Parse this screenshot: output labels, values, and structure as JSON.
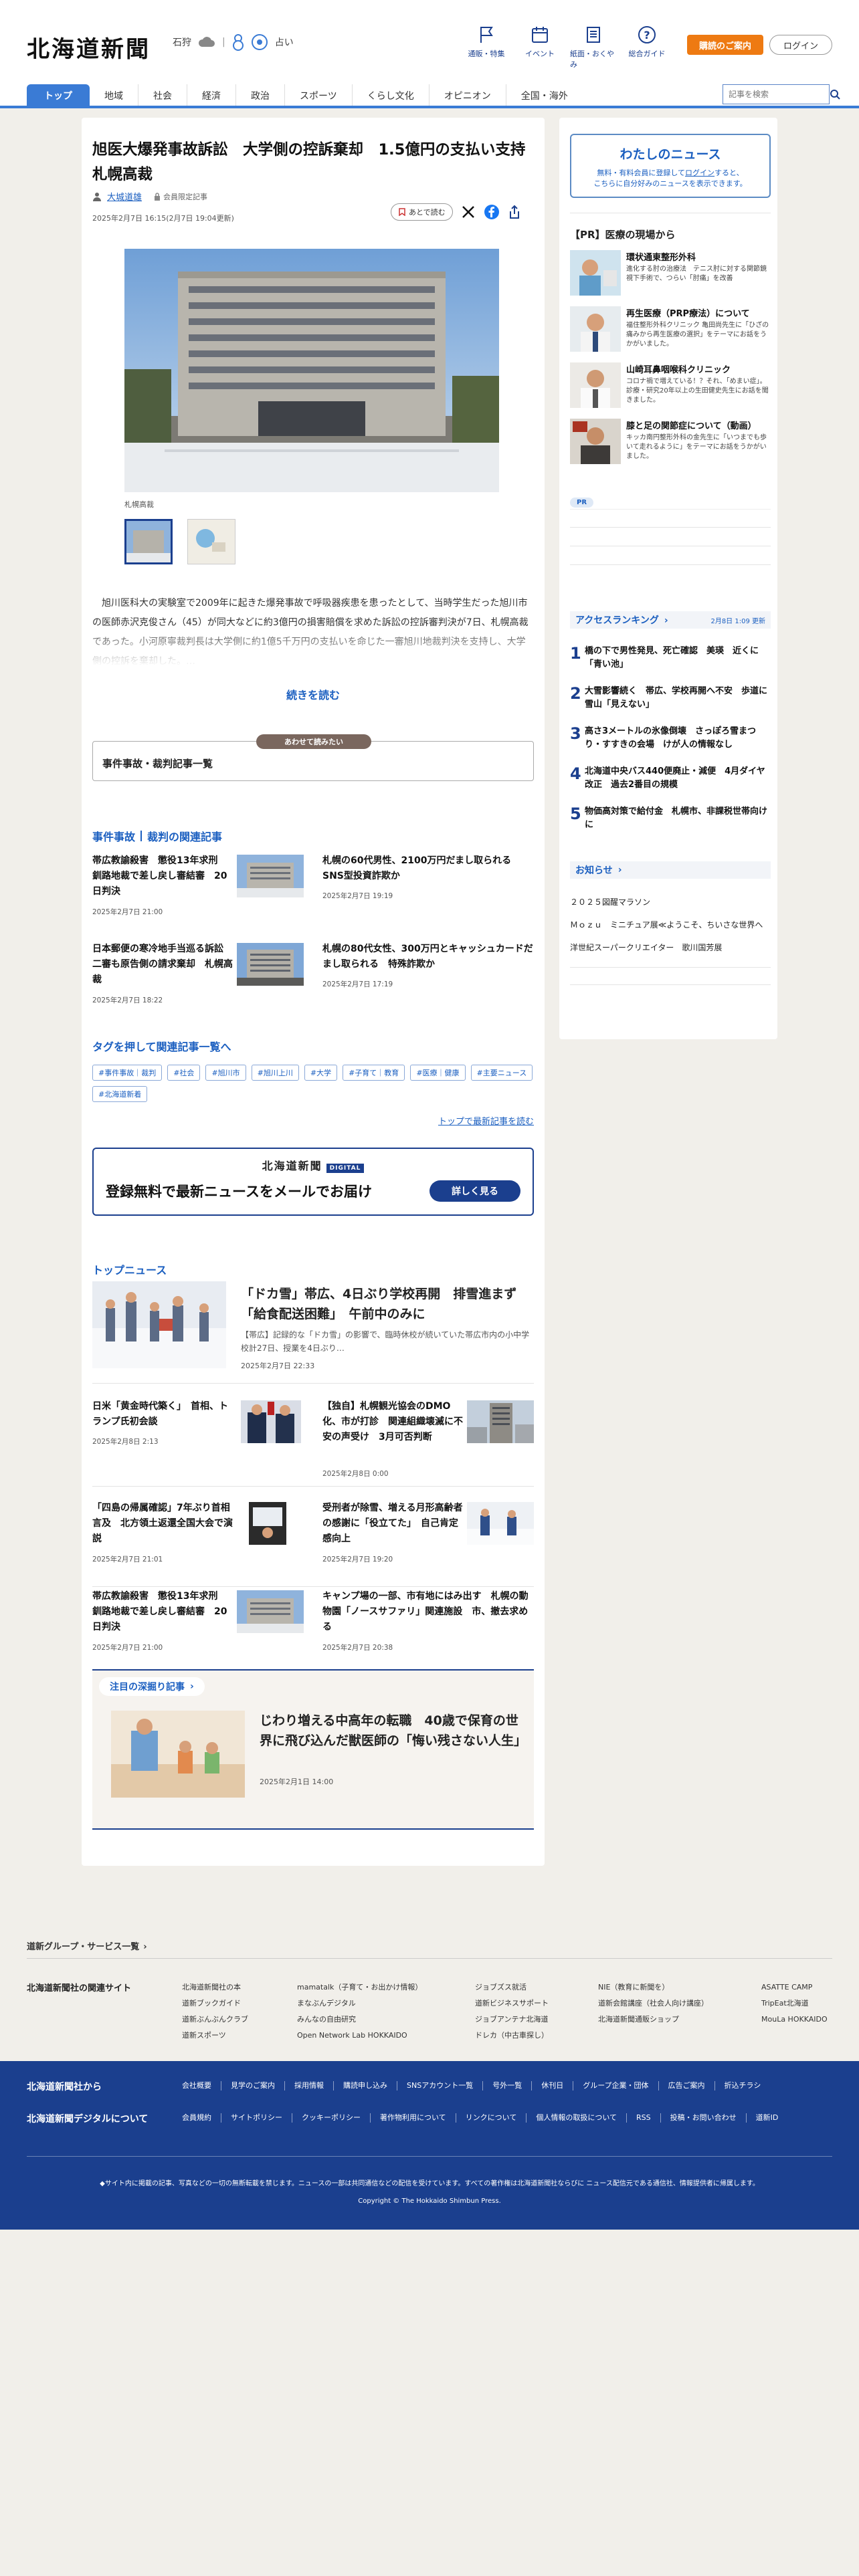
{
  "header": {
    "logo": "北海道新聞",
    "weather": {
      "region": "石狩",
      "area": "占い"
    },
    "nav_icons": [
      {
        "label": "通販・特集",
        "icon": "flag-icon"
      },
      {
        "label": "イベント",
        "icon": "calendar-icon"
      },
      {
        "label": "紙面・おくやみ",
        "icon": "newspaper-icon"
      },
      {
        "label": "総合ガイド",
        "icon": "help-icon"
      }
    ],
    "subscribe": "購読のご案内",
    "login": "ログイン"
  },
  "nav": {
    "items": [
      "トップ",
      "地域",
      "社会",
      "経済",
      "政治",
      "スポーツ",
      "くらし文化",
      "オピニオン",
      "全国・海外"
    ],
    "search_placeholder": "記事を検索"
  },
  "article": {
    "title": "旭医大爆発事故訴訟　大学側の控訴棄却　1.5億円の支払い支持　札幌高裁",
    "author": "大城道雄",
    "paid_label": "会員限定記事",
    "dates": "2025年2月7日 16:15(2月7日 19:04更新)",
    "save_label": "あとで読む",
    "photo_caption": "札幌高裁",
    "lead": "旭川医科大の実験室で2009年に起きた爆発事故で呼吸器疾患を患ったとして、当時学生だった旭川市の医師赤沢克俊さん（45）が同大などに約3億円の損害賠償を求めた訴訟の控訴審判決が7日、札幌高裁であった。小河原寧裁判長は大学側に約1億5千万円の支払いを命じた一審旭川地裁判決を支持し、大学側の控訴を棄却した。…",
    "read_more": "続きを読む",
    "also_read_pill": "あわせて読みたい",
    "also_read": "事件事故・裁判記事一覧"
  },
  "related": {
    "heading_a": "事件事故",
    "heading_b": "裁判の関連記事",
    "items": [
      {
        "title": "帯広教諭殺害　懲役13年求刑　釧路地裁で差し戻し審結審　20日判決",
        "date": "2025年2月7日 21:00"
      },
      {
        "title": "札幌の60代男性、2100万円だまし取られる　SNS型投資詐欺か",
        "date": "2025年2月7日 19:19"
      },
      {
        "title": "日本郵便の寒冷地手当巡る訴訟　二審も原告側の請求棄却　札幌高裁",
        "date": "2025年2月7日 18:22"
      },
      {
        "title": "札幌の80代女性、300万円とキャッシュカードだまし取られる　特殊詐欺か",
        "date": "2025年2月7日 17:19"
      }
    ]
  },
  "tags": {
    "heading": "タグを押して関連記事一覧へ",
    "items": [
      "#事件事故｜裁判",
      "#社会",
      "#旭川市",
      "#旭川上川",
      "#大学",
      "#子育て｜教育",
      "#医療｜健康",
      "#主要ニュース",
      "#北海道新着"
    ],
    "latest_link": "トップで最新記事を読む"
  },
  "mail_promo": {
    "brand": "北海道新聞",
    "brand_tag": "DIGITAL",
    "message": "登録無料で最新ニュースをメールでお届け",
    "button": "詳しく見る"
  },
  "top_news": {
    "heading": "トップニュース",
    "main": {
      "title": "「ドカ雪」帯広、4日ぶり学校再開　排雪進まず「給食配送困難」　午前中のみに",
      "desc": "【帯広】記録的な「ドカ雪」の影響で、臨時休校が続いていた帯広市内の小中学校計27日、授業を4日ぶり…",
      "date": "2025年2月7日 22:33"
    },
    "items": [
      {
        "title": "日米「黄金時代築く」　首相、トランプ氏初会談",
        "date": "2025年2月8日 2:13"
      },
      {
        "title": "【独自】札幌観光協会のDMO化、市が打診　関連組織壊滅に不安の声受け　3月可否判断",
        "date": "2025年2月8日 0:00"
      },
      {
        "title": "「四島の帰属確認」7年ぶり首相言及　北方領土返還全国大会で演説",
        "date": "2025年2月7日 21:01"
      },
      {
        "title": "受刑者が除雪、増える月形高齢者の感謝に「役立てた」　自己肯定感向上",
        "date": "2025年2月7日 19:20"
      },
      {
        "title": "帯広教諭殺害　懲役13年求刑　釧路地裁で差し戻し審結審　20日判決",
        "date": "2025年2月7日 21:00"
      },
      {
        "title": "キャンプ場の一部、市有地にはみ出す　札幌の動物園「ノースサファリ」関連施設　市、撤去求める",
        "date": "2025年2月7日 20:38"
      }
    ]
  },
  "deep": {
    "heading": "注目の深掘り記事",
    "title": "じわり増える中高年の転職　40歳で保育の世界に飛び込んだ獣医師の「悔い残さない人生」",
    "date": "2025年2月1日 14:00"
  },
  "sidebar": {
    "my_news": {
      "title": "わたしのニュース",
      "desc1": "無料・有料会員に登録して",
      "link": "ログイン",
      "desc2": "すると、",
      "desc3": "こちらに自分好みのニュースを表示できます。"
    },
    "pr_heading": "【PR】医療の現場から",
    "pr_items": [
      {
        "title": "環状通東整形外科",
        "desc": "進化する肘の治療法　テニス肘に対する関節鏡視下手術で、つらい「肘痛」を改善"
      },
      {
        "title": "再生医療（PRP療法）について",
        "desc": "福住整形外科クリニック 亀田尚先生に「ひざの痛みから再生医療の選択」をテーマにお話をうかがいました。"
      },
      {
        "title": "山崎耳鼻咽喉科クリニック",
        "desc": "コロナ禍で増えている！？それ、「めまい症」。診療・研究20年以上の生田健史先生にお話を聞きました。"
      },
      {
        "title": "膝と足の関節症について（動画）",
        "desc": "キッカ南円整形外科の金先生に「いつまでも歩いて走れるように」をテーマにお話をうかがいました。"
      }
    ],
    "pr_badge": "PR",
    "ranking": {
      "heading": "アクセスランキング",
      "date": "2月8日 1:09 更新",
      "items": [
        "橋の下で男性発見、死亡確認　美瑛　近くに「青い池」",
        "大雪影響続く　帯広、学校再開へ不安　歩道に雪山「見えない」",
        "高さ3メートルの氷像倒壊　さっぽろ雪まつり・すすきの会場　けが人の情報なし",
        "北海道中央バス440便廃止・減便　4月ダイヤ改正　過去2番目の規模",
        "物価高対策で給付金　札幌市、非課税世帯向けに"
      ]
    },
    "notice": {
      "heading": "お知らせ",
      "items": [
        "２０２５図醒マラソン",
        "Ｍｏｚｕ　ミニチュア展≪ようこそ、ちいさな世界へ",
        "洋世紀スーパークリエイター　歌川国芳展"
      ]
    }
  },
  "footer": {
    "group_label": "道新グループ・サービス一覧",
    "related_sites": "北海道新聞社の関連サイト",
    "cols": [
      [
        "北海道新聞社の本",
        "道新ブックガイド",
        "道新ぶんぶんクラブ",
        "道新スポーツ"
      ],
      [
        "mamatalk（子育て・お出かけ情報）",
        "まなぶんデジタル",
        "みんなの自由研究",
        "Open Network Lab HOKKAIDO"
      ],
      [
        "ジョブズス就活",
        "道新ビジネスサポート",
        "ジョブアンテナ北海道",
        "ドレカ（中古車探し）"
      ],
      [
        "NIE（教育に新聞を）",
        "道新会館講座（社会人向け講座）",
        "北海道新聞通販ショップ"
      ],
      [
        "ASATTE CAMP",
        "TripEat北海道",
        "MouLa HOKKAIDO"
      ]
    ],
    "company_heading": "北海道新聞社から",
    "company_links": [
      "会社概要",
      "見学のご案内",
      "採用情報",
      "購読申し込み",
      "SNSアカウント一覧",
      "号外一覧",
      "休刊日",
      "グループ企業・団体",
      "広告ご案内",
      "折込チラシ"
    ],
    "digital_heading": "北海道新聞デジタルについて",
    "digital_links": [
      "会員規約",
      "サイトポリシー",
      "クッキーポリシー",
      "著作物利用について",
      "リンクについて",
      "個人情報の取扱について",
      "RSS",
      "投稿・お問い合わせ",
      "道新ID"
    ],
    "note": "◆サイト内に掲載の記事、写真などの一切の無断転載を禁じます。ニュースの一部は共同通信などの配信を受けています。すべての著作権は北海道新聞社ならびに ニュース配信元である通信社、情報提供者に帰属します。",
    "copyright": "Copyright © The Hokkaido Shimbun Press."
  }
}
